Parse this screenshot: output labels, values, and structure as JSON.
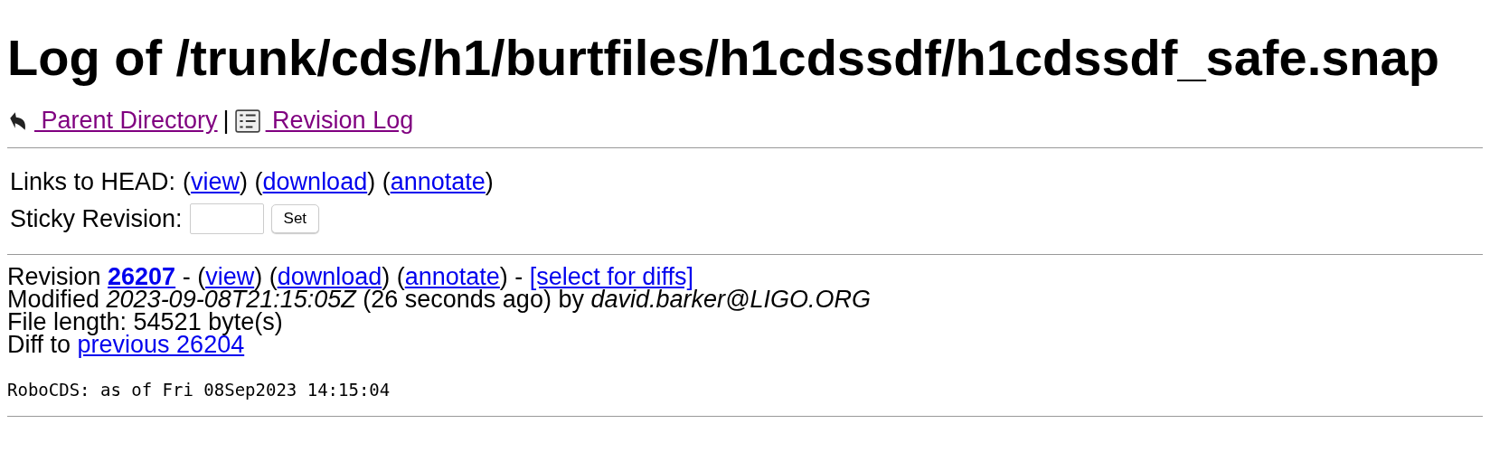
{
  "title": "Log of /trunk/cds/h1/burtfiles/h1cdssdf/h1cdssdf_safe.snap",
  "nav": [
    {
      "label": " Parent Directory",
      "kind": "back",
      "visited": true
    },
    {
      "label": " Revision Log",
      "kind": "log",
      "visited": true
    }
  ],
  "nav_separator": "|",
  "head_links": {
    "label": "Links to HEAD:",
    "segments": [
      {
        "kind": "text",
        "text": "("
      },
      {
        "kind": "link",
        "text": "view"
      },
      {
        "kind": "text",
        "text": ") ("
      },
      {
        "kind": "link",
        "text": "download"
      },
      {
        "kind": "text",
        "text": ") ("
      },
      {
        "kind": "link",
        "text": "annotate"
      },
      {
        "kind": "text",
        "text": ")"
      }
    ]
  },
  "sticky": {
    "label": "Sticky Revision:",
    "button": "Set"
  },
  "revision_lines": [
    [
      {
        "kind": "text",
        "text": "Revision "
      },
      {
        "kind": "strong-link",
        "text": "26207"
      },
      {
        "kind": "text",
        "text": " - ("
      },
      {
        "kind": "link",
        "text": "view"
      },
      {
        "kind": "text",
        "text": ") ("
      },
      {
        "kind": "link",
        "text": "download"
      },
      {
        "kind": "text",
        "text": ") ("
      },
      {
        "kind": "link",
        "text": "annotate"
      },
      {
        "kind": "text",
        "text": ") - "
      },
      {
        "kind": "link",
        "text": "[select for diffs]"
      }
    ],
    [
      {
        "kind": "text",
        "text": "Modified "
      },
      {
        "kind": "italic",
        "text": "2023-09-08T21:15:05Z"
      },
      {
        "kind": "text",
        "text": " (26 seconds ago) by "
      },
      {
        "kind": "italic",
        "text": "david.barker@LIGO.ORG"
      }
    ],
    [
      {
        "kind": "text",
        "text": "File length: 54521 byte(s)"
      }
    ],
    [
      {
        "kind": "text",
        "text": "Diff to "
      },
      {
        "kind": "link",
        "text": "previous 26204"
      }
    ]
  ],
  "log_message": "RoboCDS: as of Fri 08Sep2023 14:15:04"
}
